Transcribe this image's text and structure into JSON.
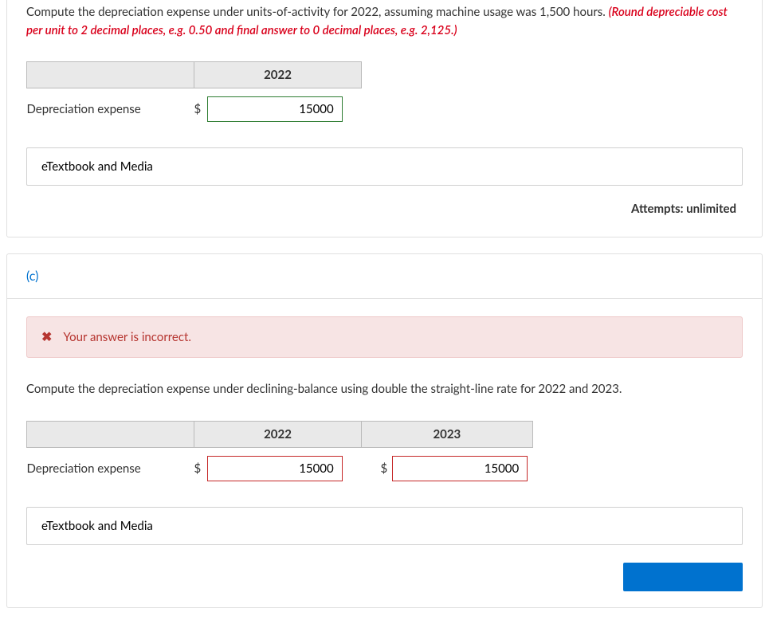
{
  "partB": {
    "prompt_plain": "Compute the depreciation expense under units-of-activity for 2022, assuming machine usage was 1,500 hours. ",
    "prompt_red": "(Round depreciable cost per unit to 2 decimal places, e.g. 0.50 and final answer to 0 decimal places, e.g. 2,125.)",
    "year_header": "2022",
    "row_label": "Depreciation expense",
    "currency": "$",
    "value": "15000",
    "etext_label": "eTextbook and Media",
    "attempts": "Attempts: unlimited"
  },
  "partC": {
    "label": "(c)",
    "feedback": "Your answer is incorrect.",
    "prompt": "Compute the depreciation expense under declining-balance using double the straight-line rate for 2022 and 2023.",
    "year1": "2022",
    "year2": "2023",
    "row_label": "Depreciation expense",
    "currency": "$",
    "value1": "15000",
    "value2": "15000",
    "etext_label": "eTextbook and Media"
  }
}
